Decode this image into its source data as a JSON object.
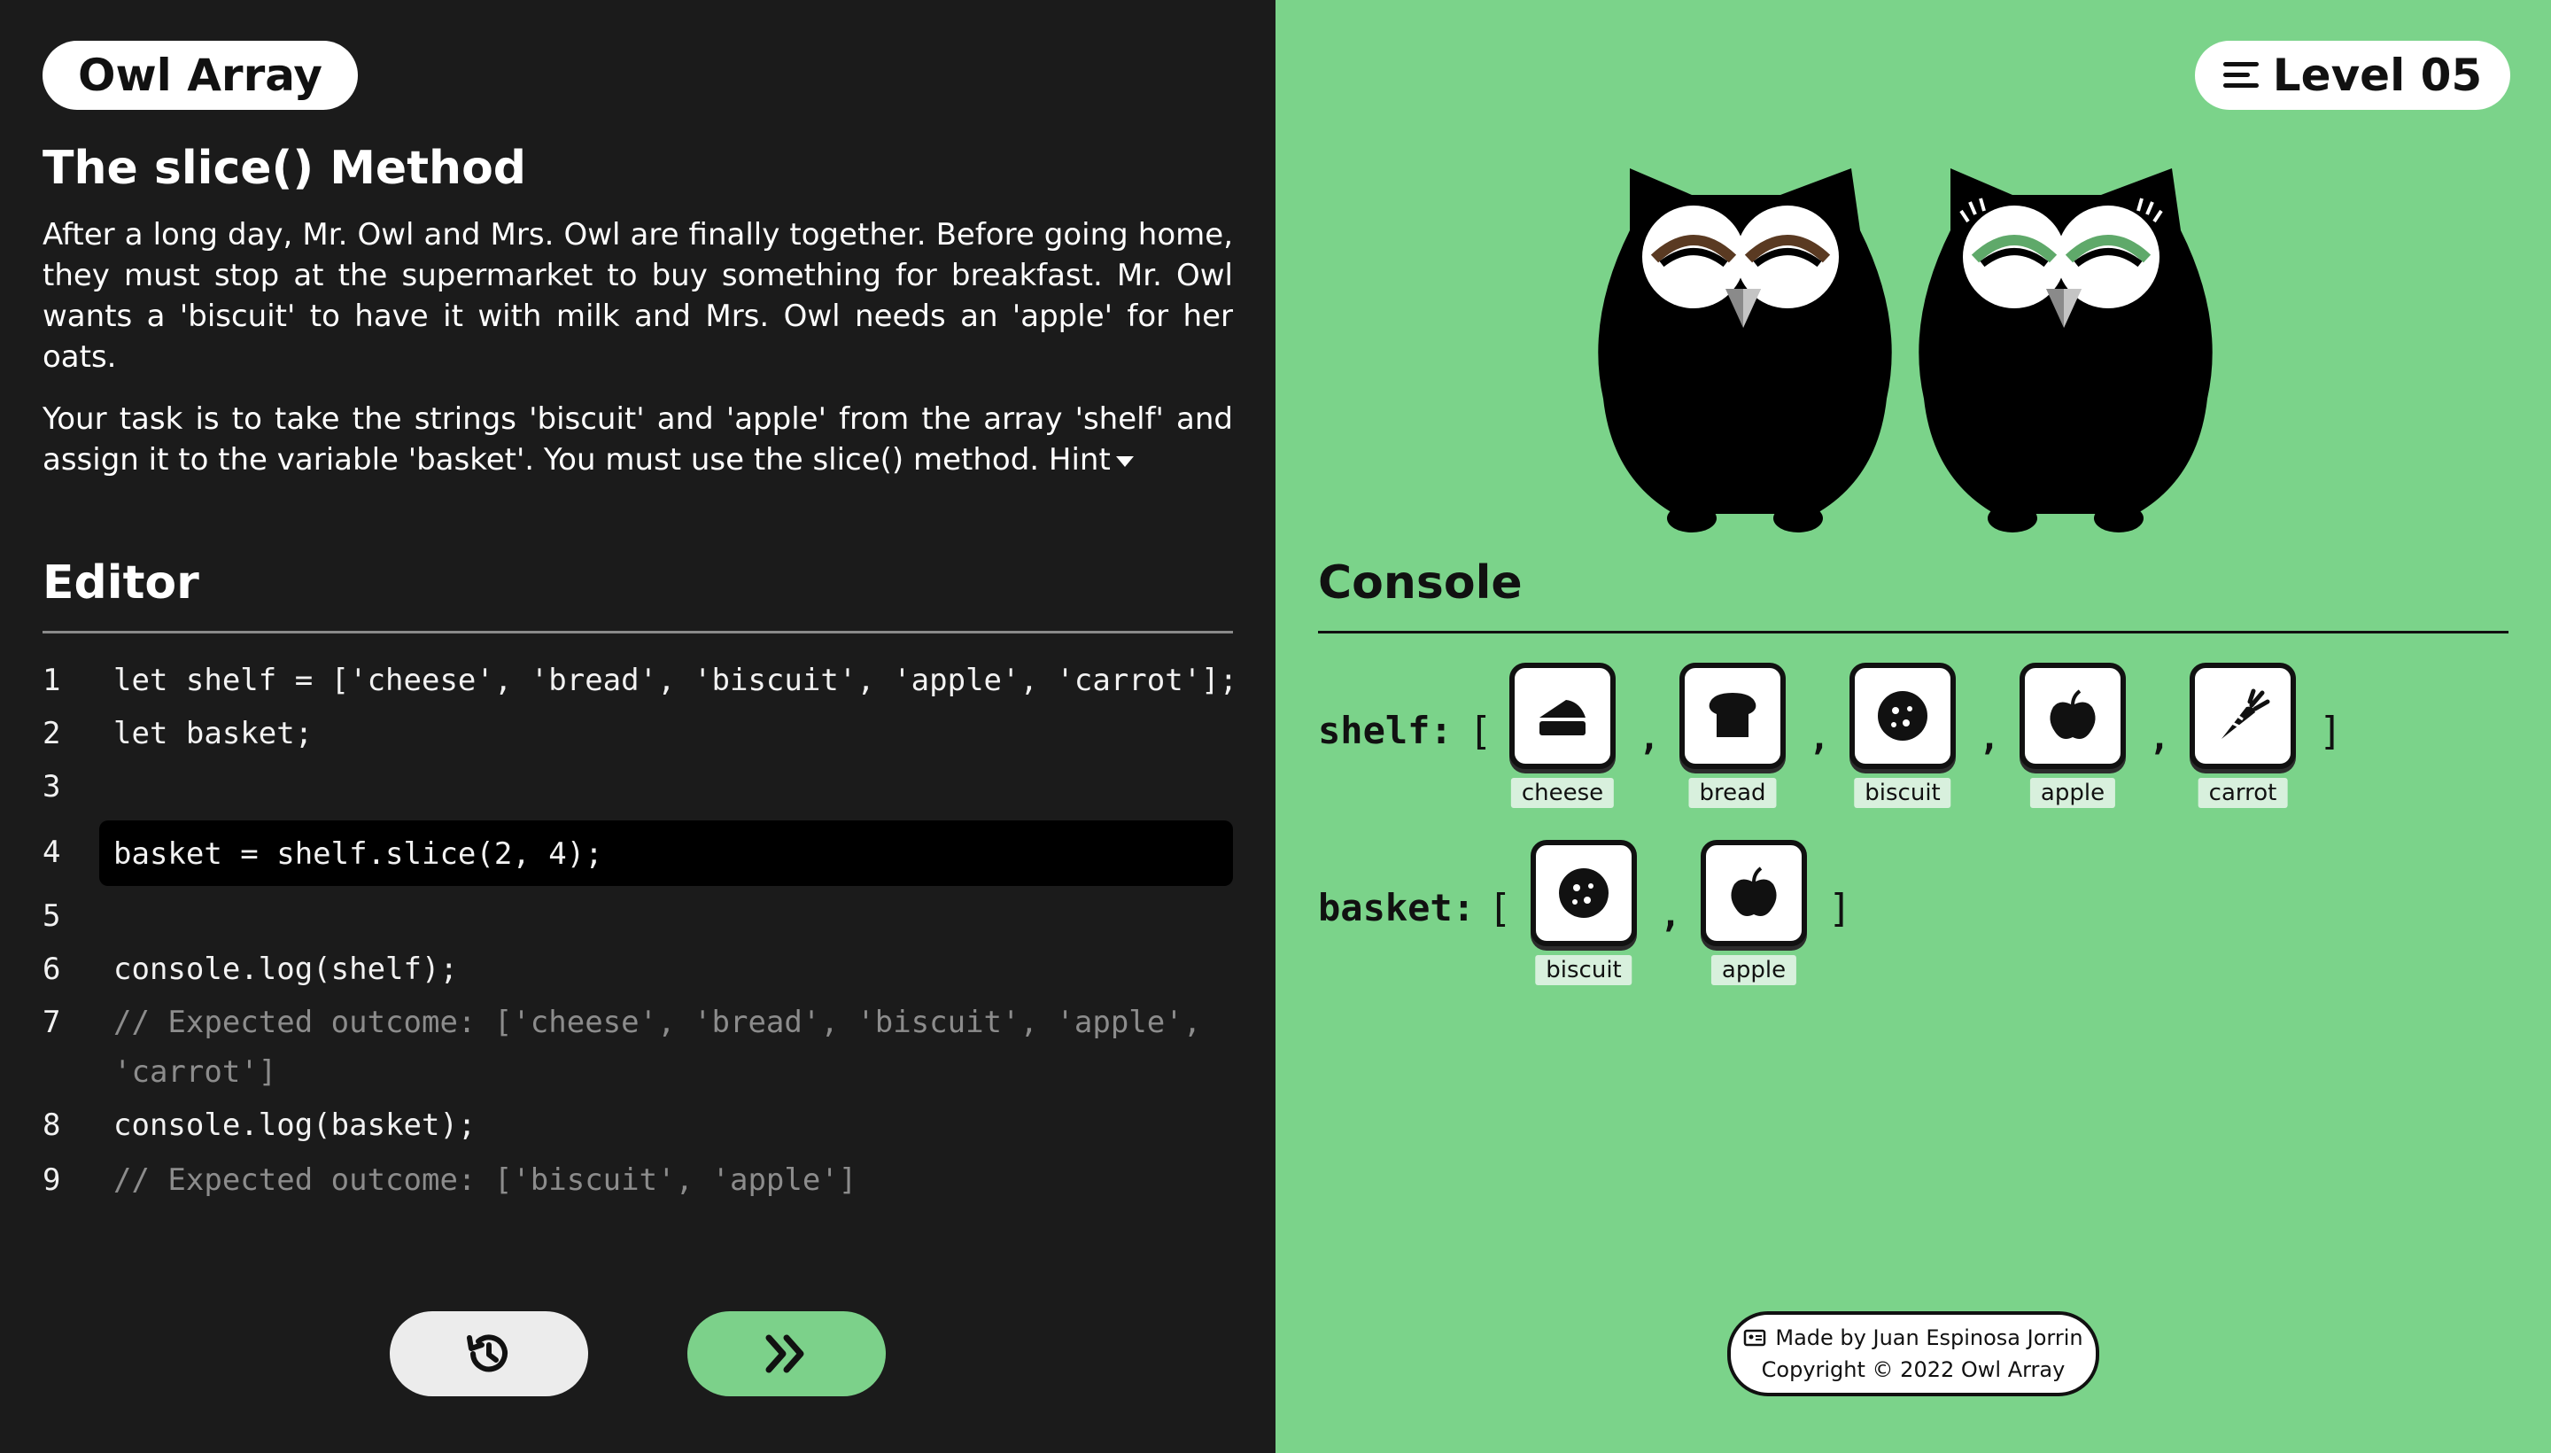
{
  "app": {
    "logo": "Owl Array"
  },
  "lesson": {
    "title": "The slice() Method",
    "paragraph1": "After a long day, Mr. Owl and Mrs. Owl are finally together. Before going home, they must stop at the supermarket to buy something for breakfast. Mr. Owl wants a 'biscuit' to have it with milk and Mrs. Owl needs an 'apple' for her oats.",
    "paragraph2": "Your task is to take the strings 'biscuit' and 'apple' from the array 'shelf' and assign it to the variable 'basket'. You must use the slice() method.",
    "hint": "Hint"
  },
  "editor": {
    "title": "Editor",
    "lines": [
      {
        "n": "1",
        "code": "let shelf = ['cheese', 'bread', 'biscuit', 'apple', 'carrot'];"
      },
      {
        "n": "2",
        "code": "let basket;"
      },
      {
        "n": "3",
        "code": ""
      },
      {
        "n": "4",
        "code": ""
      },
      {
        "n": "5",
        "code": ""
      },
      {
        "n": "6",
        "code": "console.log(shelf);"
      },
      {
        "n": "7",
        "code": "// Expected outcome: ['cheese', 'bread', 'biscuit', 'apple',",
        "code_cont": "'carrot']"
      },
      {
        "n": "8",
        "code": "console.log(basket);"
      },
      {
        "n": "9",
        "code": "// Expected outcome: ['biscuit', 'apple']"
      }
    ],
    "input_value": "basket = shelf.slice(2, 4);"
  },
  "buttons": {
    "reset_icon": "history-icon",
    "run_icon": "fast-forward-icon"
  },
  "level": {
    "label": "Level 05",
    "icon": "menu-icon"
  },
  "console": {
    "title": "Console",
    "shelf_label": "shelf:",
    "basket_label": "basket:",
    "open_bracket": "[",
    "close_bracket": "]",
    "comma": ",",
    "shelf_items": [
      "cheese",
      "bread",
      "biscuit",
      "apple",
      "carrot"
    ],
    "basket_items": [
      "biscuit",
      "apple"
    ]
  },
  "credits": {
    "line1": "Made by Juan Espinosa Jorrin",
    "line2": "Copyright © 2022 Owl Array"
  },
  "colors": {
    "left_bg": "#1b1b1b",
    "right_bg": "#7bd38a",
    "run_button": "#7cd18a",
    "code_input_bg": "#000000"
  }
}
